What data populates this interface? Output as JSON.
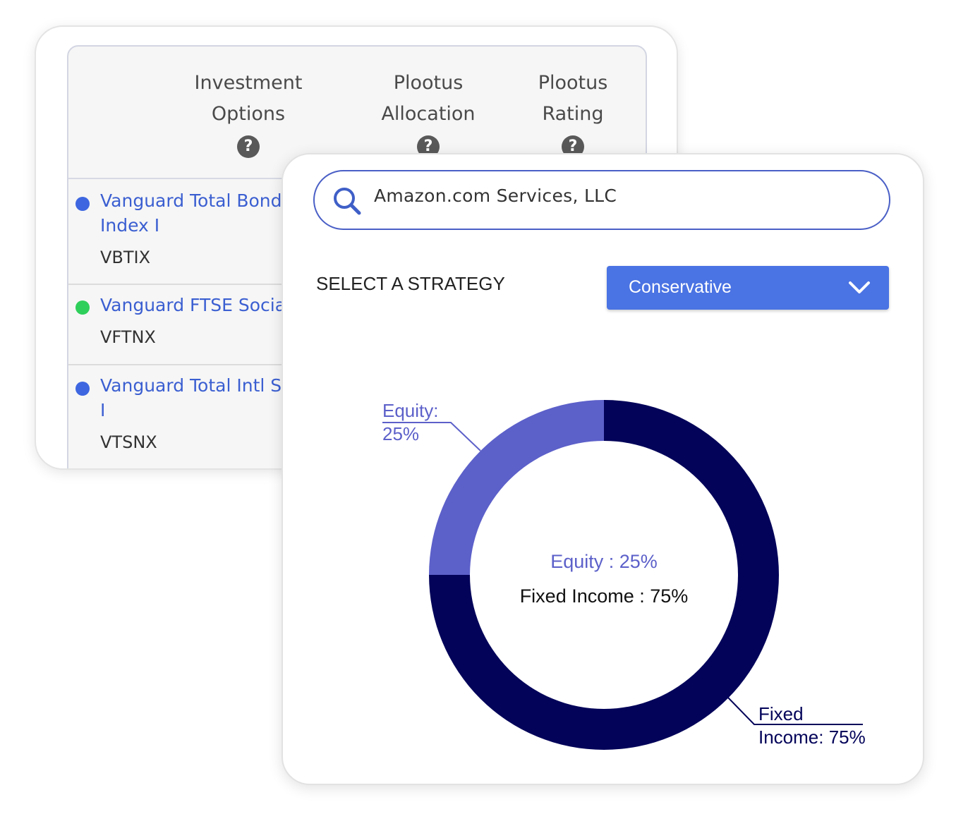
{
  "table": {
    "headers": [
      {
        "line1": "Investment",
        "line2": "Options"
      },
      {
        "line1": "Plootus",
        "line2": "Allocation"
      },
      {
        "line1": "Plootus",
        "line2": "Rating"
      }
    ],
    "help_icon_glyph": "?",
    "rows": [
      {
        "name_line1": "Vanguard Total Bond M",
        "name_line2": "Index I",
        "ticker": "VBTIX",
        "dot_color": "#3d66e0"
      },
      {
        "name_line1": "Vanguard FTSE Social",
        "name_line2": "",
        "ticker": "VFTNX",
        "dot_color": "#2ecf5a"
      },
      {
        "name_line1": "Vanguard Total Intl Sto",
        "name_line2": "I",
        "ticker": "VTSNX",
        "dot_color": "#3d66e0"
      }
    ]
  },
  "search": {
    "value": "Amazon.com Services, LLC",
    "icon": "search-icon"
  },
  "strategy": {
    "label": "SELECT A STRATEGY",
    "selected": "Conservative",
    "icon": "chevron-down-icon"
  },
  "colors": {
    "equity": "#5c60c9",
    "fixed_income": "#03035a",
    "accent": "#4a73e3",
    "link": "#3b5fd1"
  },
  "chart_data": {
    "type": "pie",
    "categories": [
      "Equity",
      "Fixed Income"
    ],
    "values": [
      25,
      75
    ],
    "colors": [
      "#5c60c9",
      "#03035a"
    ],
    "center_lines": [
      "Equity : 25%",
      "Fixed Income : 75%"
    ],
    "callouts": [
      {
        "line1": "Equity:",
        "line2": "25%"
      },
      {
        "line1": "Fixed",
        "line2": "Income: 75%"
      }
    ]
  }
}
